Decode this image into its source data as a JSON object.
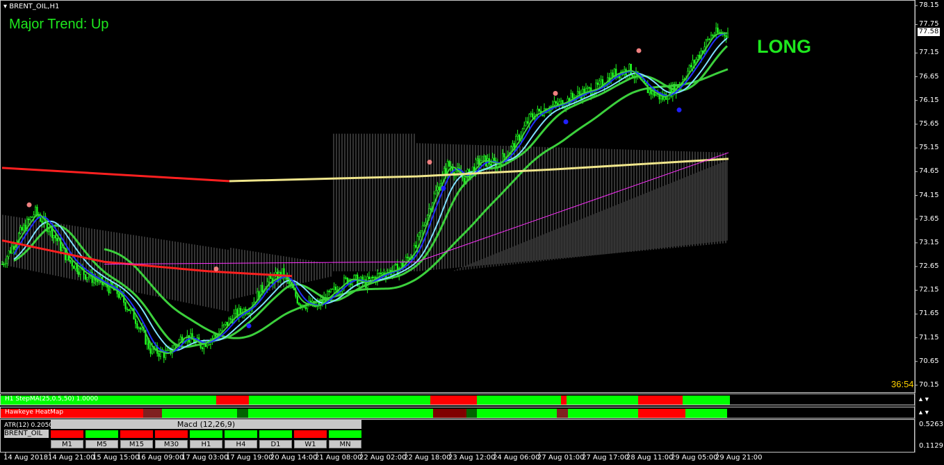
{
  "chart_title": "BRENT_OIL,H1",
  "trend_label": "Major Trend: Up",
  "signal_label": "LONG",
  "countdown": "36:54",
  "current_price": "77.58",
  "colors": {
    "background": "#000000",
    "bull_candle": "#20ff20",
    "bear_candle": "#00c000",
    "up_color": "#00ff00",
    "down_color": "#ff0000",
    "text_green": "#1ee81e"
  },
  "chart_data": {
    "type": "line",
    "title": "BRENT_OIL,H1",
    "ylim": [
      70.15,
      78.15
    ],
    "y_ticks": [
      "78.15",
      "77.75",
      "77.15",
      "76.65",
      "76.15",
      "75.65",
      "75.15",
      "74.65",
      "74.15",
      "73.65",
      "73.15",
      "72.65",
      "72.15",
      "71.65",
      "71.15",
      "70.65",
      "70.15"
    ],
    "x_ticks": [
      "14 Aug 2018",
      "14 Aug 21:00",
      "15 Aug 15:00",
      "16 Aug 09:00",
      "17 Aug 03:00",
      "17 Aug 19:00",
      "20 Aug 14:00",
      "21 Aug 08:00",
      "22 Aug 02:00",
      "22 Aug 18:00",
      "23 Aug 12:00",
      "24 Aug 06:00",
      "27 Aug 01:00",
      "27 Aug 17:00",
      "28 Aug 11:00",
      "29 Aug 05:00",
      "29 Aug 21:00"
    ],
    "close_path": [
      72.7,
      73.3,
      73.8,
      73.4,
      72.8,
      72.5,
      72.3,
      72.1,
      71.6,
      70.9,
      70.8,
      71.2,
      71.0,
      71.2,
      71.6,
      71.8,
      72.3,
      72.5,
      71.9,
      71.8,
      72.1,
      72.4,
      72.3,
      72.5,
      72.6,
      73.0,
      74.0,
      74.8,
      74.5,
      74.9,
      74.8,
      75.2,
      75.8,
      76.0,
      76.1,
      76.3,
      76.4,
      76.7,
      76.8,
      76.4,
      76.2,
      76.5,
      77.0,
      77.55,
      77.58
    ],
    "signal_dots": {
      "pink": [
        [
          42,
          73.95
        ],
        [
          311,
          72.6
        ],
        [
          618,
          74.85
        ],
        [
          799,
          76.3
        ],
        [
          919,
          77.2
        ]
      ],
      "blue": [
        [
          358,
          71.4
        ],
        [
          638,
          74.3
        ],
        [
          814,
          75.7
        ],
        [
          977,
          75.95
        ]
      ]
    },
    "ylabel": "",
    "xlabel": ""
  },
  "indicators": {
    "stepma": {
      "label": "H1 StepMA(25,0.5,50) 1.0000",
      "segments": [
        [
          "up",
          0,
          178
        ],
        [
          "up",
          178,
          310
        ],
        [
          "down",
          310,
          357
        ],
        [
          "up",
          357,
          618
        ],
        [
          "down",
          618,
          685
        ],
        [
          "up",
          685,
          806
        ],
        [
          "down",
          806,
          814
        ],
        [
          "up",
          814,
          917
        ],
        [
          "down",
          917,
          981
        ],
        [
          "up",
          981,
          1049
        ]
      ]
    },
    "heatmap": {
      "label": "Hawkeye HeatMap",
      "segments": [
        [
          "down",
          0,
          205
        ],
        [
          "dark",
          205,
          232
        ],
        [
          "up",
          232,
          340
        ],
        [
          "dark2",
          340,
          356
        ],
        [
          "up",
          356,
          622
        ],
        [
          "darkred",
          622,
          670
        ],
        [
          "dark2",
          670,
          685
        ],
        [
          "up",
          685,
          800
        ],
        [
          "dark",
          800,
          816
        ],
        [
          "up",
          816,
          917
        ],
        [
          "down",
          917,
          985
        ],
        [
          "up",
          985,
          1045
        ]
      ]
    },
    "atr_label": "ATR(12) 0.2050",
    "macd_label": "Macd (12,26,9)",
    "symbol_box": "BRENT_OIL",
    "timeframes": [
      "M1",
      "M5",
      "M15",
      "M30",
      "H1",
      "H4",
      "D1",
      "W1",
      "MN"
    ],
    "tf_colors": [
      "down",
      "up",
      "down",
      "down",
      "up",
      "up",
      "up",
      "down",
      "up"
    ],
    "atr_ticks": [
      "0.5263",
      "0.1129"
    ]
  }
}
